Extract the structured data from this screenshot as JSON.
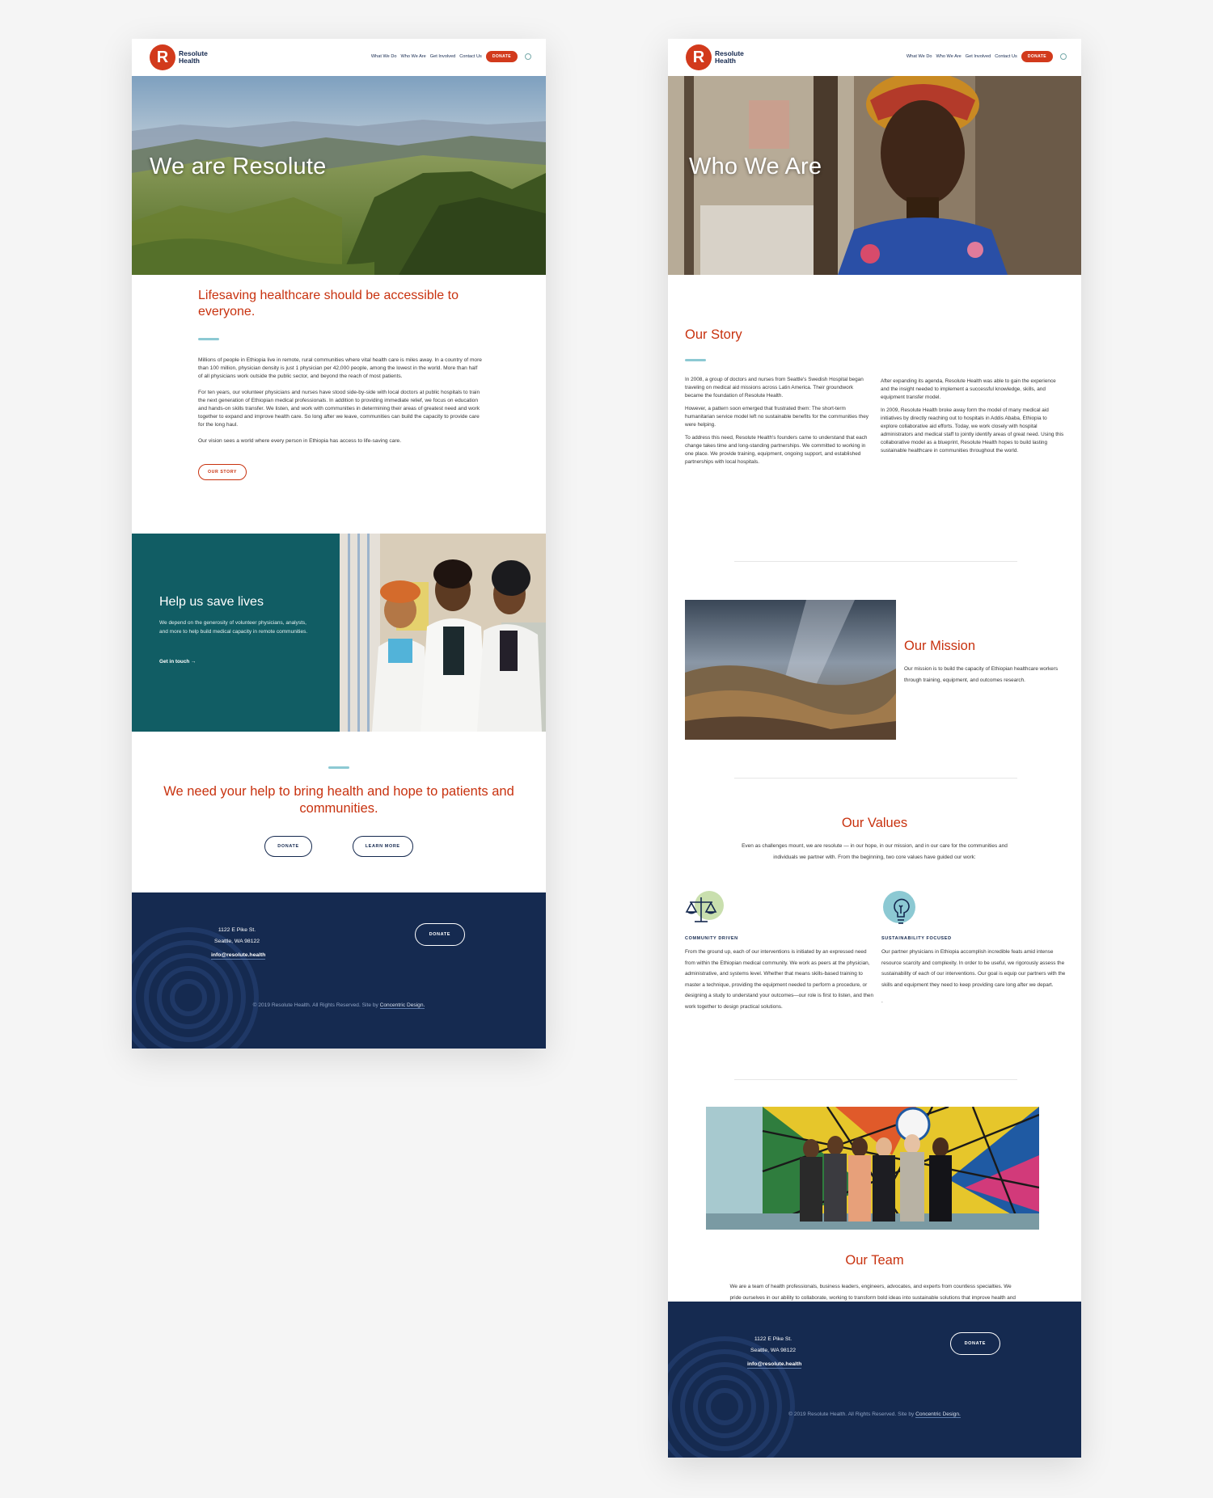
{
  "header": {
    "logo_mark": "R",
    "logo_text": "Resolute Health",
    "nav": [
      "What We Do",
      "Who We Are",
      "Get Involved",
      "Contact Us"
    ],
    "donate": "DONATE"
  },
  "home": {
    "hero_title": "We are Resolute",
    "intro_heading": "Lifesaving healthcare should be accessible to everyone.",
    "paragraphs": [
      "Millions of people in Ethiopia live in remote, rural communities where vital health care is miles away. In a country of more than 100 million, physician density is  just 1 physician per 42,000 people, among the lowest in the world. More than half of all physicians work outside the public sector, and beyond the reach of most patients.",
      "For ten years, our volunteer physicians and nurses have stood side-by-side with local doctors at public hospitals to train the next generation of Ethiopian medical professionals. In addition to providing immediate relief, we focus on education and hands-on skills transfer.  We listen, and work with communities in determining their areas of greatest need and work together to expand and improve health care. So long after we leave, communities can build the capacity to provide care for the long haul.",
      "Our vision sees a world where every person in Ethiopia has access to life-saving care."
    ],
    "our_story_btn": "OUR STORY",
    "help_heading": "Help us save lives",
    "help_text": "We depend on the generosity of volunteer physicians, analysts, and more to help build medical capacity in remote communities.",
    "help_link": "Get in touch →",
    "cta_heading": "We need your help to bring health and hope to patients and communities.",
    "cta_donate": "DONATE",
    "cta_learn": "LEARN MORE"
  },
  "who": {
    "hero_title": "Who We Are",
    "story_heading": "Our Story",
    "story_col1": [
      "In 2008, a group of doctors and nurses from Seattle's Swedish Hospital began traveling on medical aid missions across Latin America. Their groundwork became the foundation of Resolute Health.",
      "However, a pattern soon emerged that frustrated them: The short-term humanitarian service model left no sustainable benefits for the communities they were helping.",
      "To address this need, Resolute Health's founders came to understand that each change takes time and long-standing partnerships. We committed to working in one place. We provide training, equipment, ongoing support, and established partnerships with local hospitals."
    ],
    "story_col2": [
      "After expanding its agenda, Resolute Health was able to gain the experience and the insight needed to implement a successful knowledge, skills, and equipment transfer model.",
      "In 2009, Resolute Health broke away form the model of many medical aid initiatives by directly reaching out to hospitals in Addis Ababa, Ethiopia to explore collaborative aid efforts. Today, we work closely with hospital administrators and medical staff to jointly identify areas of great need. Using this collaborative model as a blueprint, Resolute Health hopes to build lasting sustainable healthcare in communities throughout the world."
    ],
    "mission_heading": "Our Mission",
    "mission_text": "Our mission is to build the capacity of Ethiopian healthcare workers through training, equipment, and outcomes research.",
    "values_heading": "Our Values",
    "values_lead": "Even as challenges mount, we are resolute — in our hope, in our mission, and in our care for the communities and individuals we partner with. From the beginning, two core values have guided our work:",
    "values": [
      {
        "icon": "scales-icon",
        "title": "COMMUNITY DRIVEN",
        "text": "From the ground up, each of our interventions is initiated by an expressed need from within the Ethiopian medical community. We work as peers at the physician, administrative, and systems level. Whether that means skills-based training to master a technique, providing the equipment needed to perform a procedure, or designing a study to understand your outcomes—our role is first to listen, and then work together to design practical solutions."
      },
      {
        "icon": "lightbulb-icon",
        "title": "SUSTAINABILITY FOCUSED",
        "text": "Our partner physicians in Ethiopia accomplish incredible feats amid intense resource scarcity and complexity. In order to be useful, we rigorously assess the sustainability of each of our interventions. Our goal is equip our partners with the skills and equipment they need to keep providing care long after we depart."
      }
    ],
    "values_trailing_dot": ".",
    "team_heading": "Our Team",
    "team_text": "We are a team of health professionals, business leaders, engineers, advocates, and experts from countless specialties. We pride ourselves in our ability to collaborate, working to transform bold ideas into sustainable solutions that improve health and well-being for all in the long run."
  },
  "footer": {
    "address_line1": "1122 E Pike St.",
    "address_line2": "Seattle, WA 98122",
    "email": "info@resolute.health",
    "donate": "DONATE",
    "copyright": "© 2019 Resolute Health. All Rights Reserved. Site by ",
    "credit": "Concentric Design."
  },
  "colors": {
    "brand_red": "#c8320f",
    "navy": "#152a50",
    "teal": "#115d64",
    "accent_teal": "#8cc9d3"
  }
}
